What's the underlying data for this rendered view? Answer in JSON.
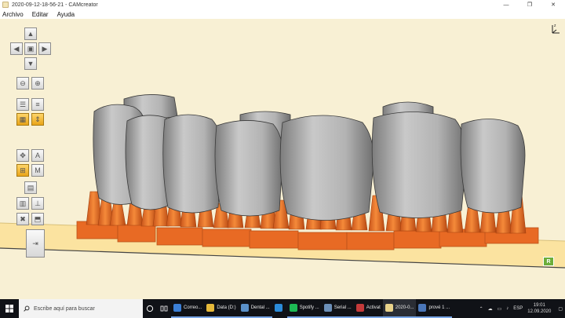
{
  "window": {
    "title": "2020-09-12-18-56-21 - CAMcreator",
    "minimize_glyph": "—",
    "maximize_glyph": "❐",
    "close_glyph": "✕"
  },
  "menu": {
    "items": [
      "Archivo",
      "Editar",
      "Ayuda"
    ]
  },
  "viewport": {
    "orientation_label": "z",
    "render_badge": "R",
    "colors": {
      "background": "#f8f0d4",
      "floor": "#fbe3a0",
      "tooth": "#b9b9b9",
      "support": "#f07a2a",
      "active_tool": "#f2b530"
    }
  },
  "toolbar": {
    "tools": [
      {
        "name": "pan-up",
        "icon": "arrow-up-icon",
        "active": false
      },
      {
        "name": "pan-left",
        "icon": "arrow-left-icon",
        "active": false
      },
      {
        "name": "reset-view",
        "icon": "cube-icon",
        "active": false
      },
      {
        "name": "pan-right",
        "icon": "arrow-right-icon",
        "active": false
      },
      {
        "name": "pan-down",
        "icon": "arrow-down-icon",
        "active": false
      },
      {
        "name": "zoom-out",
        "icon": "zoom-out-icon",
        "active": false
      },
      {
        "name": "zoom-in",
        "icon": "zoom-in-icon",
        "active": false
      },
      {
        "name": "layers-view",
        "icon": "layers-icon",
        "active": false
      },
      {
        "name": "layers-alt",
        "icon": "layers-stack-icon",
        "active": false
      },
      {
        "name": "frame-tool",
        "icon": "frame-icon",
        "active": true
      },
      {
        "name": "align-tool",
        "icon": "align-icon",
        "active": true
      },
      {
        "name": "move-tool",
        "icon": "move-icon",
        "active": false
      },
      {
        "name": "auto-arrange",
        "icon": "auto-arrange-icon",
        "active": false
      },
      {
        "name": "support-tool",
        "icon": "support-icon",
        "active": true
      },
      {
        "name": "manual-tool",
        "icon": "manual-icon",
        "active": false
      },
      {
        "name": "slice-tool",
        "icon": "slice-icon",
        "active": false
      },
      {
        "name": "supports-list",
        "icon": "list-icon",
        "active": false
      },
      {
        "name": "measure-tool",
        "icon": "measure-icon",
        "active": false
      },
      {
        "name": "delete-tool",
        "icon": "delete-icon",
        "active": false
      },
      {
        "name": "export-tool",
        "icon": "export-icon",
        "active": false
      },
      {
        "name": "exit-tool",
        "icon": "exit-icon",
        "active": false
      }
    ]
  },
  "taskbar": {
    "search_placeholder": "Escribe aquí para buscar",
    "tasks": [
      {
        "label": "Correo...",
        "color": "#3b7fd6",
        "state": "open"
      },
      {
        "label": "Data (D:)",
        "color": "#e6b93a",
        "state": "open"
      },
      {
        "label": "Dental ...",
        "color": "#5a90c8",
        "state": "open"
      },
      {
        "label": "",
        "color": "#2b8bd8",
        "state": "none"
      },
      {
        "label": "Spotify ...",
        "color": "#1db954",
        "state": "open"
      },
      {
        "label": "Serial ...",
        "color": "#6b8fb8",
        "state": "open"
      },
      {
        "label": "Activat",
        "color": "#c43a3a",
        "state": "open"
      },
      {
        "label": "2020-0...",
        "color": "#e8d28a",
        "state": "active"
      },
      {
        "label": "prové 1 ...",
        "color": "#4a76b8",
        "state": "open"
      }
    ],
    "tray": {
      "language": "ESP",
      "time": "19:01",
      "date": "12.09.2020"
    }
  }
}
